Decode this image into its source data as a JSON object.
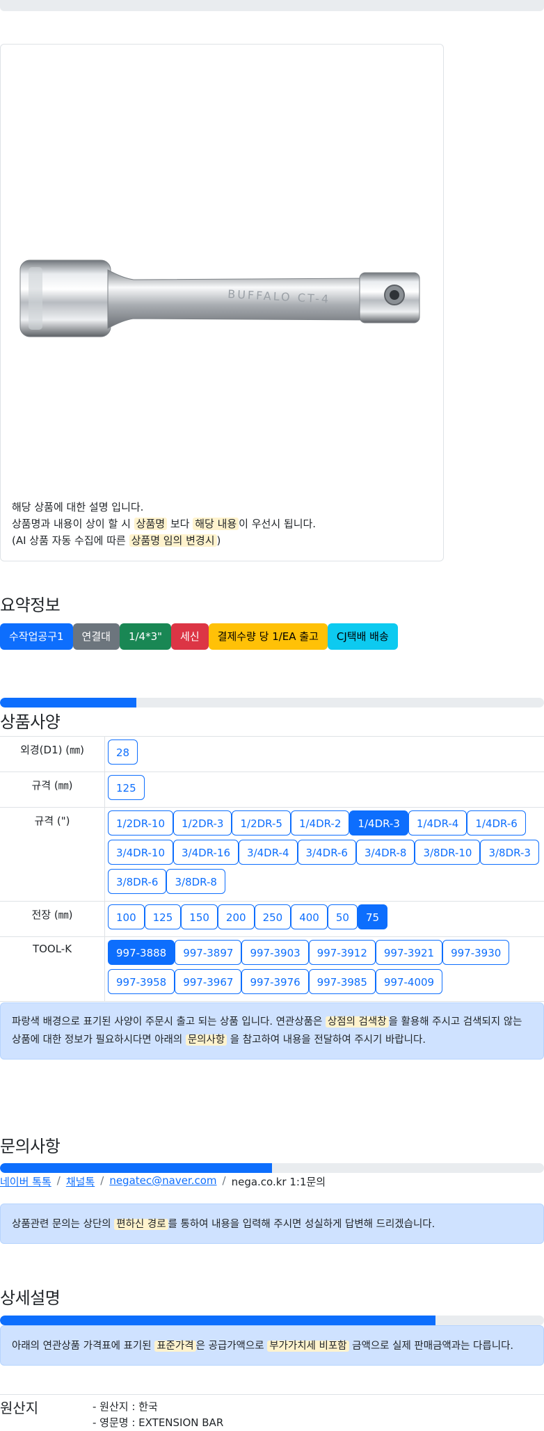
{
  "product": {
    "description_lines": {
      "line1": "해당 상품에 대한 설명 입니다.",
      "line2_a": "상품명과 내용이 상이 할 시 ",
      "line2_hl1": "상품명",
      "line2_b": " 보다 ",
      "line2_hl2": "해당 내용",
      "line2_c": "이 우선시 됩니다.",
      "line3_a": "(AI 상품 자동 수집에 따른 ",
      "line3_hl": "상품명 임의 변경시",
      "line3_b": ")"
    },
    "image_engraving": "BUFFALO CT-4"
  },
  "summary": {
    "title": "요약정보",
    "badges": [
      {
        "label": "수작업공구1",
        "color": "#0d6efd"
      },
      {
        "label": "연결대",
        "color": "#6c757d"
      },
      {
        "label": "1/4*3\"",
        "color": "#198754"
      },
      {
        "label": "세신",
        "color": "#dc3545"
      },
      {
        "label": "결제수량 당 1/EA 출고",
        "color": "#ffc107"
      },
      {
        "label": "CJ택배 배송",
        "color": "#0dcaf0"
      }
    ]
  },
  "spec": {
    "title": "상품사양",
    "progress_percent": 25,
    "rows": [
      {
        "label": "외경(D1) (㎜)",
        "options": [
          "28"
        ],
        "selected": []
      },
      {
        "label": "규격 (㎜)",
        "options": [
          "125"
        ],
        "selected": []
      },
      {
        "label": "규격 (\")",
        "options": [
          "1/2DR-10",
          "1/2DR-3",
          "1/2DR-5",
          "1/4DR-2",
          "1/4DR-3",
          "1/4DR-4",
          "1/4DR-6",
          "3/4DR-10",
          "3/4DR-16",
          "3/4DR-4",
          "3/4DR-6",
          "3/4DR-8",
          "3/8DR-10",
          "3/8DR-3",
          "3/8DR-6",
          "3/8DR-8"
        ],
        "selected": [
          "1/4DR-3"
        ]
      },
      {
        "label": "전장 (㎜)",
        "options": [
          "100",
          "125",
          "150",
          "200",
          "250",
          "400",
          "50",
          "75"
        ],
        "selected": [
          "75"
        ]
      },
      {
        "label": "TOOL-K",
        "options": [
          "997-3888",
          "997-3897",
          "997-3903",
          "997-3912",
          "997-3921",
          "997-3930",
          "997-3958",
          "997-3967",
          "997-3976",
          "997-3985",
          "997-4009"
        ],
        "selected": [
          "997-3888"
        ]
      }
    ],
    "notice": {
      "a": "파랑색 배경으로 표기된 사양이 주문시 출고 되는 상품 입니다. 연관상품은 ",
      "hl1": "상점의 검색창",
      "b": "을 활용해 주시고 검색되지 않는 상품에 대한 정보가 필요하시다면 아래의 ",
      "hl2": "문의사항",
      "c": " 을 참고하여 내용을 전달하여 주시기 바랍니다."
    }
  },
  "inquiry": {
    "title": "문의사항",
    "progress_percent": 50,
    "links": [
      "네이버 톡톡",
      "채널톡",
      "negatec@naver.com"
    ],
    "last": "nega.co.kr 1:1문의",
    "notice": {
      "a": "상품관련 문의는 상단의 ",
      "hl": "편하신 경로",
      "b": "를 통하여 내용을 입력해 주시면 성실하게 답변해 드리겠습니다."
    }
  },
  "detail": {
    "title": "상세설명",
    "progress_percent": 80,
    "notice": {
      "a": "아래의 연관상품 가격표에 표기된 ",
      "hl1": "표준가격",
      "b": "은 공급가액으로 ",
      "hl2": "부가가치세 비포함",
      "c": " 금액으로 실제 판매금액과는 다릅니다."
    }
  },
  "origin": {
    "label": "원산지",
    "items": [
      "- 원산지 : 한국",
      "- 영문명 : EXTENSION BAR"
    ]
  }
}
